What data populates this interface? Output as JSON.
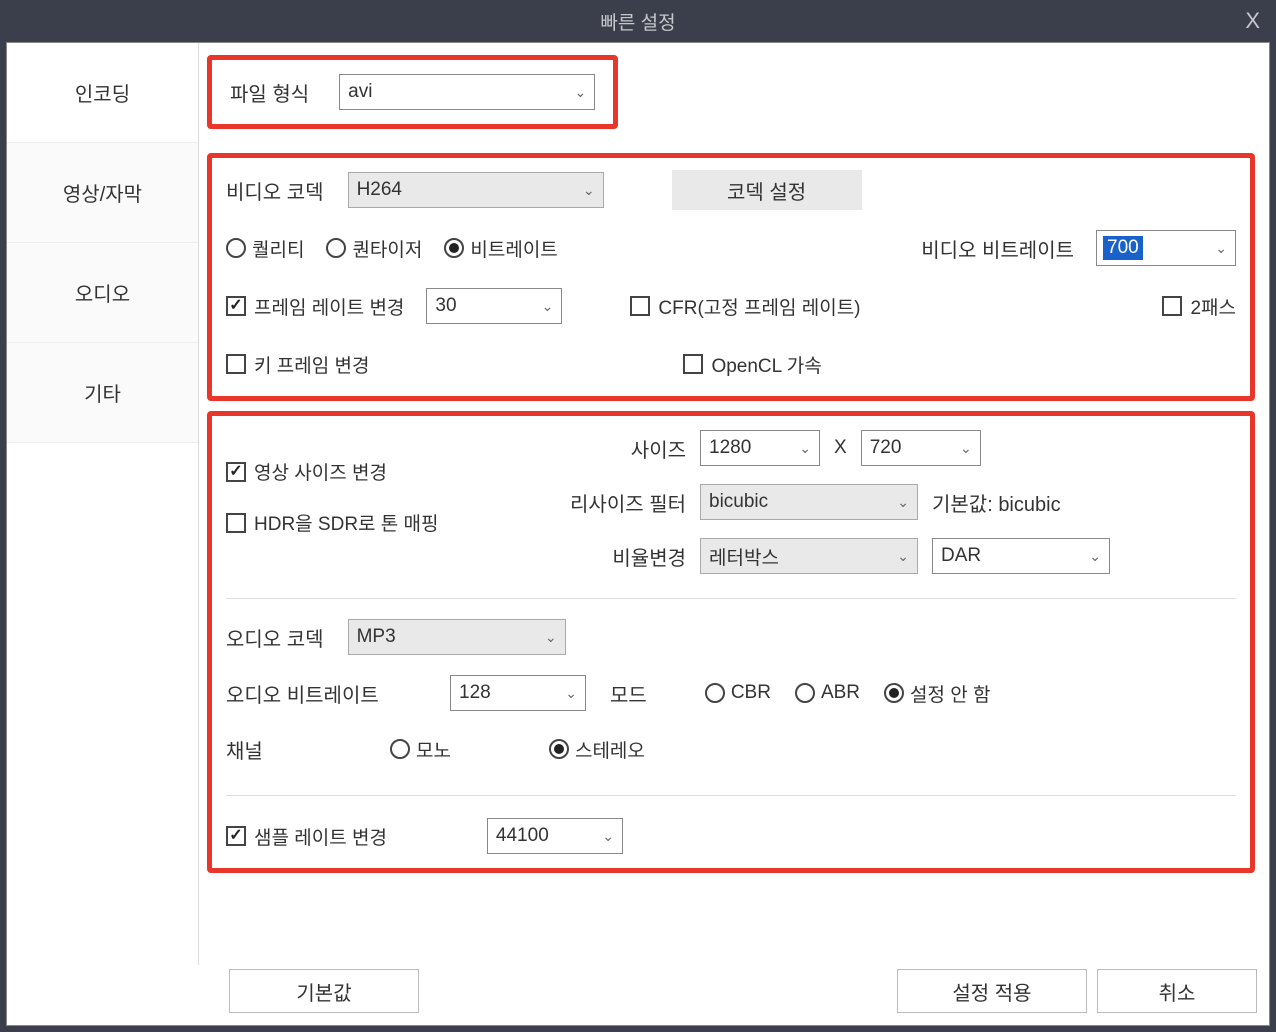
{
  "window": {
    "title": "빠른 설정",
    "close": "X"
  },
  "tabs": {
    "encoding": "인코딩",
    "video_subtitle": "영상/자막",
    "audio": "오디오",
    "etc": "기타"
  },
  "file_format": {
    "label": "파일 형식",
    "value": "avi"
  },
  "video": {
    "codec_label": "비디오 코덱",
    "codec_value": "H264",
    "codec_settings_btn": "코덱 설정",
    "quality": "퀄리티",
    "quantizer": "퀀타이저",
    "bitrate": "비트레이트",
    "video_bitrate_label": "비디오 비트레이트",
    "video_bitrate_value": "700",
    "change_framerate": "프레임 레이트 변경",
    "framerate_value": "30",
    "cfr": "CFR(고정 프레임 레이트)",
    "two_pass": "2패스",
    "change_keyframe": "키 프레임 변경",
    "opencl": "OpenCL 가속"
  },
  "size": {
    "change_size": "영상 사이즈 변경",
    "hdr_sdr": "HDR을 SDR로 톤 매핑",
    "size_label": "사이즈",
    "width": "1280",
    "x_separator": "X",
    "height": "720",
    "resize_filter_label": "리사이즈 필터",
    "resize_filter_value": "bicubic",
    "resize_filter_default": "기본값: bicubic",
    "ratio_label": "비율변경",
    "ratio_value": "레터박스",
    "dar_value": "DAR"
  },
  "audio": {
    "codec_label": "오디오 코덱",
    "codec_value": "MP3",
    "bitrate_label": "오디오 비트레이트",
    "bitrate_value": "128",
    "mode_label": "모드",
    "cbr": "CBR",
    "abr": "ABR",
    "none": "설정 안 함",
    "channel_label": "채널",
    "mono": "모노",
    "stereo": "스테레오",
    "sample_rate_change": "샘플 레이트 변경",
    "sample_rate_value": "44100"
  },
  "buttons": {
    "default": "기본값",
    "apply": "설정 적용",
    "cancel": "취소"
  }
}
